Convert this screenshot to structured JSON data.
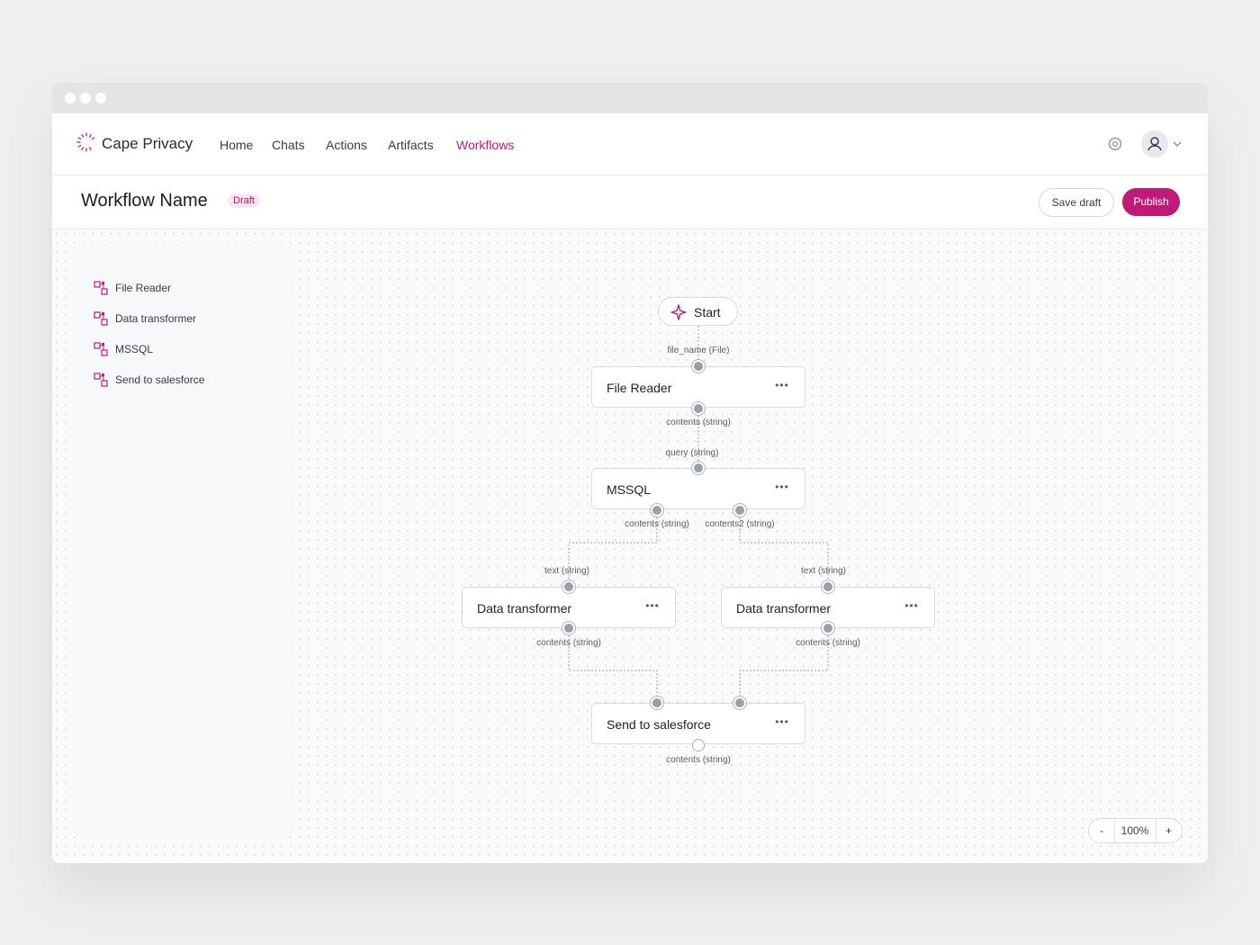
{
  "app": {
    "brand": "Cape Privacy"
  },
  "nav": {
    "items": [
      {
        "label": "Home"
      },
      {
        "label": "Chats"
      },
      {
        "label": "Actions"
      },
      {
        "label": "Artifacts"
      },
      {
        "label": "Workflows",
        "active": true
      }
    ]
  },
  "header": {
    "title": "Workflow Name",
    "status_badge": "Draft",
    "save_label": "Save draft",
    "publish_label": "Publish"
  },
  "palette": {
    "items": [
      {
        "label": "File Reader",
        "icon": "component-icon"
      },
      {
        "label": "Data transformer",
        "icon": "component-icon"
      },
      {
        "label": "MSSQL",
        "icon": "component-icon"
      },
      {
        "label": "Send to salesforce",
        "icon": "component-icon"
      }
    ]
  },
  "workflow": {
    "start": {
      "label": "Start",
      "output": "file_name (File)"
    },
    "nodes": {
      "file_reader": {
        "label": "File Reader",
        "output": "contents (string)"
      },
      "mssql": {
        "label": "MSSQL",
        "input": "query (string)",
        "output_1": "contents (string)",
        "output_2": "contents2 (string)"
      },
      "transformer_left": {
        "label": "Data transformer",
        "input": "text (string)",
        "output": "contents (string)"
      },
      "transformer_right": {
        "label": "Data transformer",
        "input": "text (string)",
        "output": "contents (string)"
      },
      "salesforce": {
        "label": "Send to salesforce",
        "output": "contents (string)"
      }
    },
    "menu_glyph": "•••"
  },
  "zoom": {
    "minus": "-",
    "value": "100%",
    "plus": "+"
  },
  "colors": {
    "accent": "#c01a78",
    "badge_bg": "#fbe6f1",
    "canvas_bg": "#fbfbfc"
  }
}
